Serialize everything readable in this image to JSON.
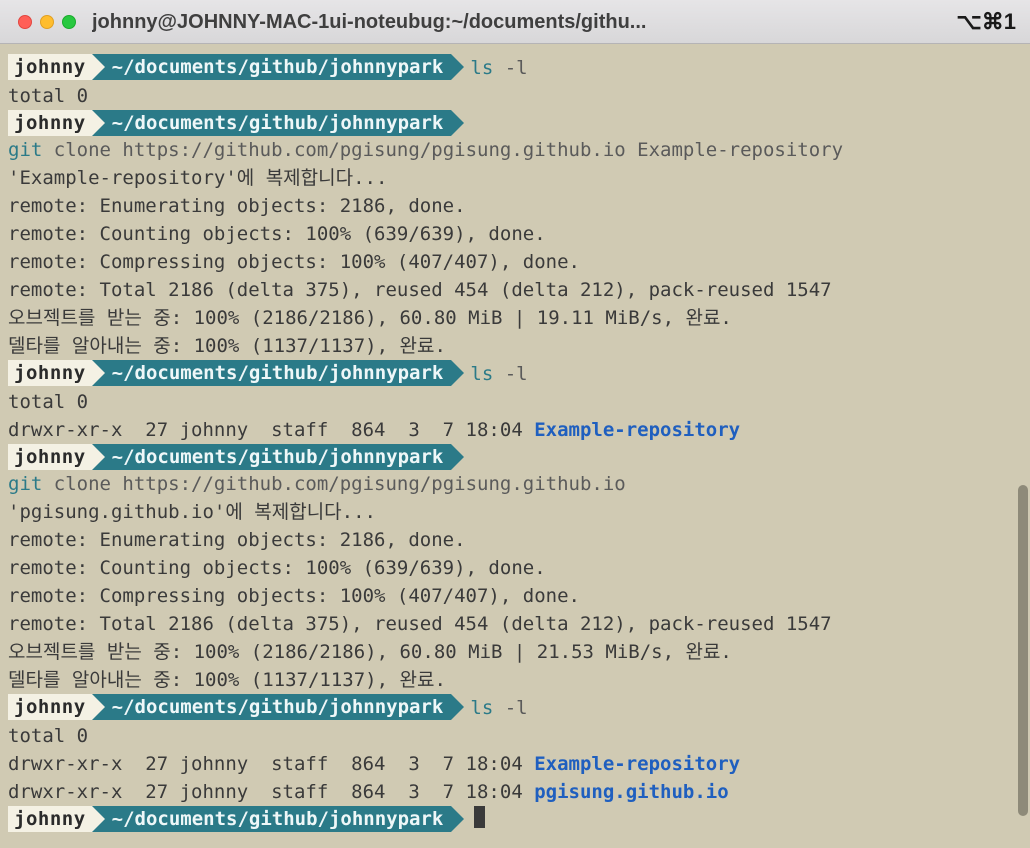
{
  "window": {
    "title": "johnny@JOHNNY-MAC-1ui-noteubug:~/documents/githu...",
    "shortcut": "⌥⌘1"
  },
  "prompt": {
    "user": "johnny",
    "path": "~/documents/github/johnnypark"
  },
  "blocks": [
    {
      "cmd_main": "ls",
      "cmd_rest": " -l",
      "out": [
        "total 0"
      ]
    },
    {
      "cmd_main": "git",
      "cmd_rest": " clone https://github.com/pgisung/pgisung.github.io Example-repository",
      "out": [
        "'Example-repository'에 복제합니다...",
        "remote: Enumerating objects: 2186, done.",
        "remote: Counting objects: 100% (639/639), done.",
        "remote: Compressing objects: 100% (407/407), done.",
        "remote: Total 2186 (delta 375), reused 454 (delta 212), pack-reused 1547",
        "오브젝트를 받는 중: 100% (2186/2186), 60.80 MiB | 19.11 MiB/s, 완료.",
        "델타를 알아내는 중: 100% (1137/1137), 완료."
      ]
    },
    {
      "cmd_main": "ls",
      "cmd_rest": " -l",
      "out": [
        "total 0",
        {
          "ls": "drwxr-xr-x  27 johnny  staff  864  3  7 18:04 ",
          "dir": "Example-repository"
        }
      ]
    },
    {
      "cmd_main": "git",
      "cmd_rest": " clone https://github.com/pgisung/pgisung.github.io",
      "out": [
        "'pgisung.github.io'에 복제합니다...",
        "remote: Enumerating objects: 2186, done.",
        "remote: Counting objects: 100% (639/639), done.",
        "remote: Compressing objects: 100% (407/407), done.",
        "remote: Total 2186 (delta 375), reused 454 (delta 212), pack-reused 1547",
        "오브젝트를 받는 중: 100% (2186/2186), 60.80 MiB | 21.53 MiB/s, 완료.",
        "델타를 알아내는 중: 100% (1137/1137), 완료."
      ]
    },
    {
      "cmd_main": "ls",
      "cmd_rest": " -l",
      "out": [
        "total 0",
        {
          "ls": "drwxr-xr-x  27 johnny  staff  864  3  7 18:04 ",
          "dir": "Example-repository"
        },
        {
          "ls": "drwxr-xr-x  27 johnny  staff  864  3  7 18:04 ",
          "dir": "pgisung.github.io"
        }
      ]
    },
    {
      "cmd_main": "",
      "cmd_rest": "",
      "cursor": true,
      "out": []
    }
  ]
}
